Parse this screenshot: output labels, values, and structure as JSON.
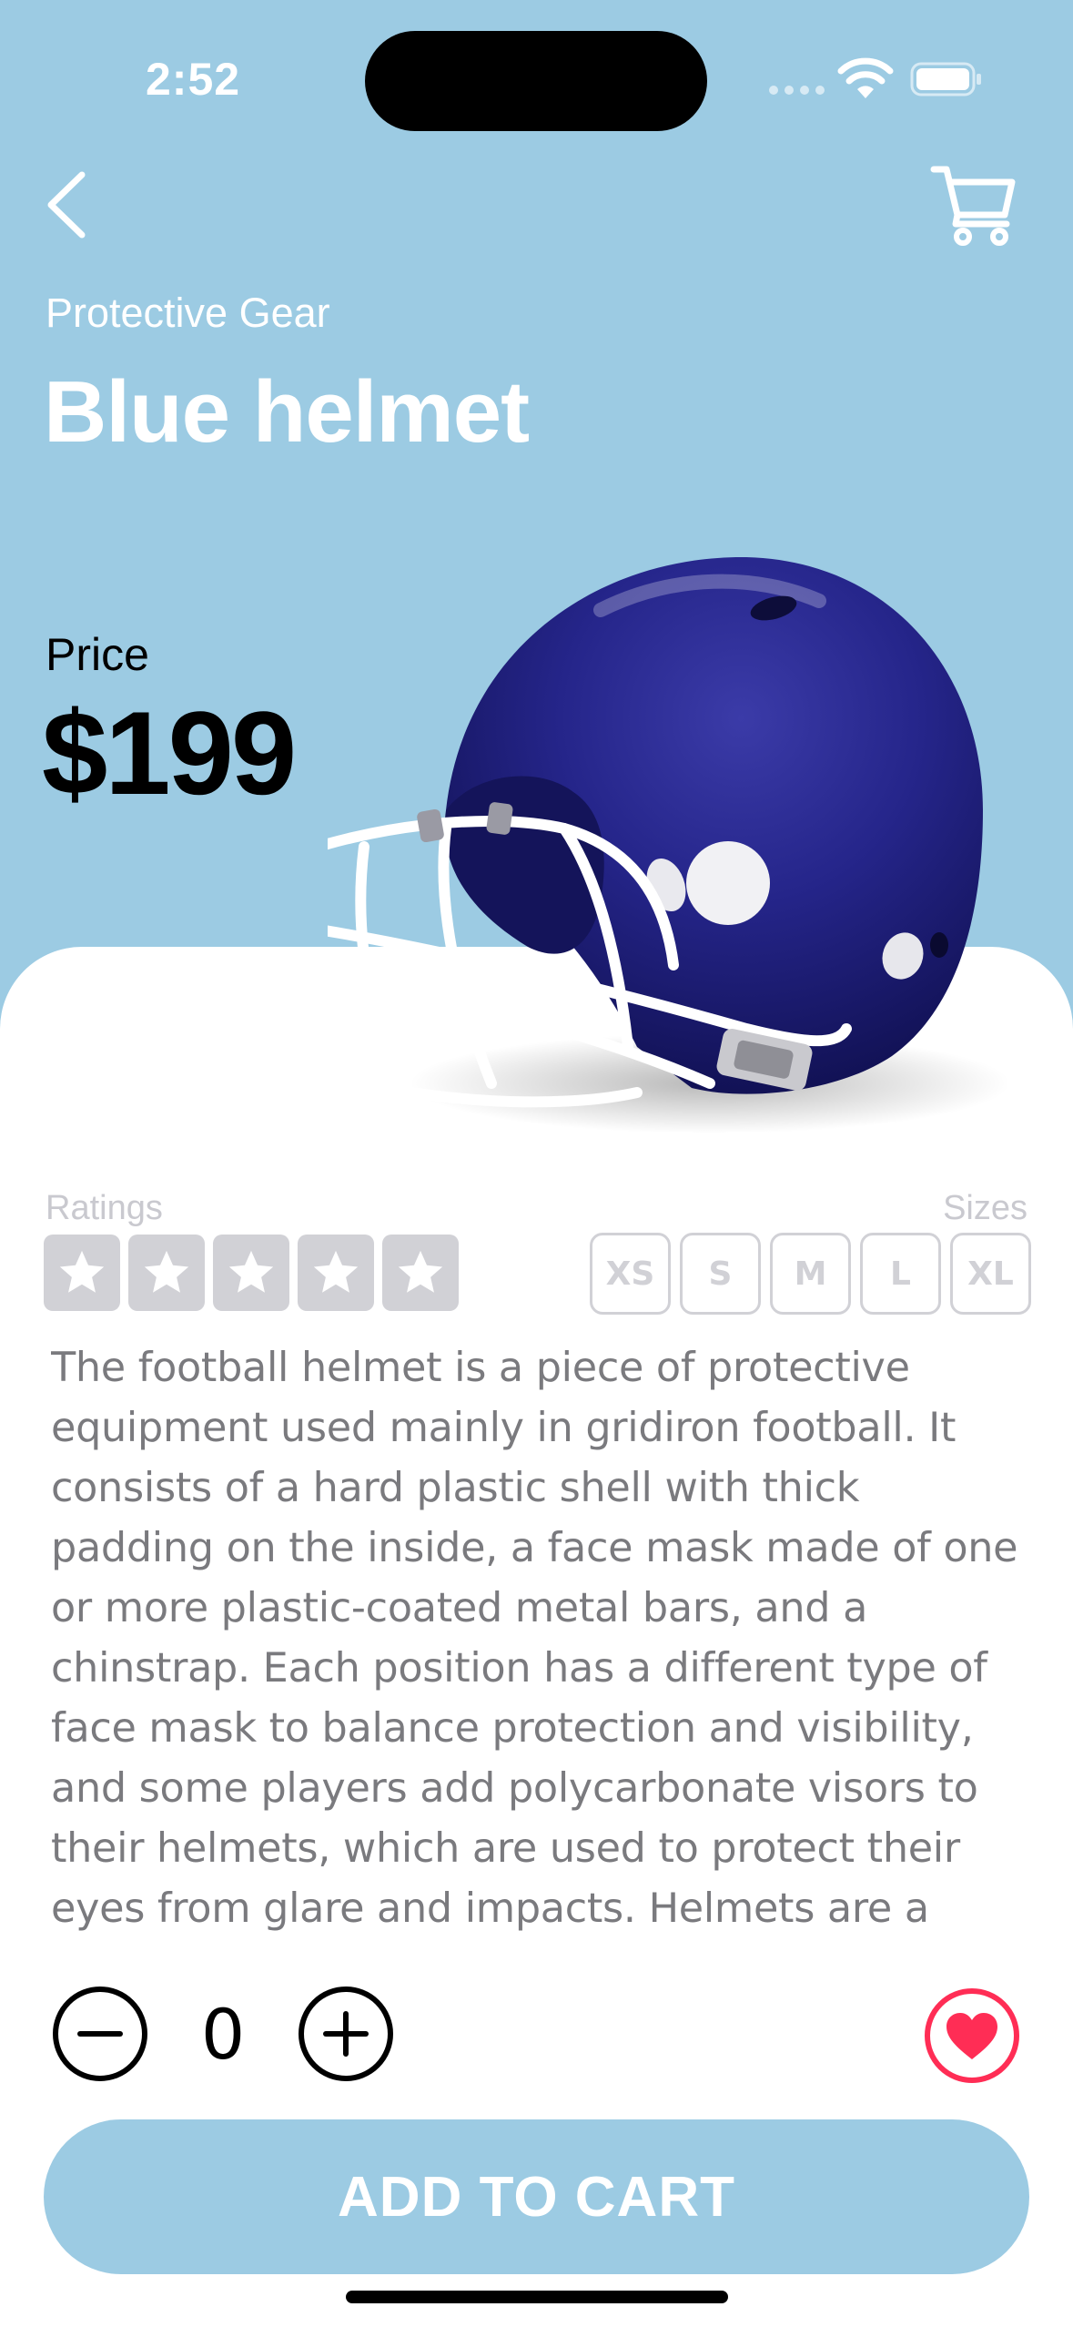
{
  "status_bar": {
    "time": "2:52"
  },
  "header": {
    "category": "Protective Gear",
    "title": "Blue helmet",
    "back_icon": "chevron-left-icon",
    "cart_icon": "cart-icon"
  },
  "price": {
    "label": "Price",
    "value": "$199"
  },
  "ratings": {
    "label": "Ratings",
    "max": 5,
    "value": 0
  },
  "sizes": {
    "label": "Sizes",
    "options": [
      "XS",
      "S",
      "M",
      "L",
      "XL"
    ]
  },
  "description": "The football helmet is a piece of protective equipment used mainly in gridiron football. It consists of a hard plastic shell with thick padding on the inside, a face mask made of one or more plastic-coated metal bars, and a chinstrap. Each position has a different type of face mask to balance protection and visibility, and some players add polycarbonate visors to their helmets, which are used to protect their eyes from glare and impacts. Helmets are a",
  "quantity": {
    "value": "0"
  },
  "add_button": {
    "label": "ADD TO CART"
  },
  "colors": {
    "background": "#9ccbe3",
    "favorite": "#ff2d55",
    "disabled": "#d1d1d6",
    "text_secondary": "#7a7a7e"
  }
}
